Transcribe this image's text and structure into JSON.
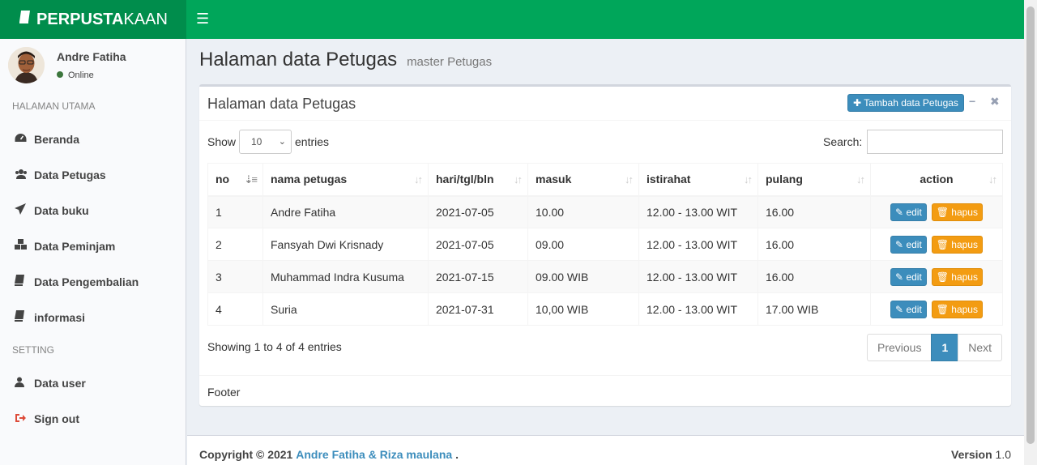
{
  "app": {
    "logo_bold": "PERPUSTA",
    "logo_rest": "KAAN"
  },
  "user": {
    "name": "Andre Fatiha",
    "status": "Online"
  },
  "sidebar": {
    "header_main": "HALAMAN UTAMA",
    "items": [
      {
        "label": "Beranda",
        "icon": "dashboard-icon"
      },
      {
        "label": "Data Petugas",
        "icon": "users-icon"
      },
      {
        "label": "Data buku",
        "icon": "send-icon"
      },
      {
        "label": "Data Peminjam",
        "icon": "cubes-icon"
      },
      {
        "label": "Data Pengembalian",
        "icon": "book-icon"
      },
      {
        "label": "informasi",
        "icon": "book-icon"
      }
    ],
    "header_setting": "SETTING",
    "setting_items": [
      {
        "label": "Data user",
        "icon": "user-icon"
      },
      {
        "label": "Sign out",
        "icon": "sign-out-icon"
      }
    ]
  },
  "page": {
    "title": "Halaman data Petugas",
    "subtitle": "master Petugas"
  },
  "box": {
    "title": "Halaman data Petugas",
    "add_button": "Tambah data Petugas",
    "show_label": "Show",
    "length_value": "10",
    "entries_label": "entries",
    "search_label": "Search:",
    "info": "Showing 1 to 4 of 4 entries",
    "pager": {
      "previous": "Previous",
      "current": "1",
      "next": "Next"
    },
    "footer": "Footer"
  },
  "table": {
    "columns": [
      "no",
      "nama petugas",
      "hari/tgl/bln",
      "masuk",
      "istirahat",
      "pulang",
      "action"
    ],
    "rows": [
      [
        "1",
        "Andre Fatiha",
        "2021-07-05",
        "10.00",
        "12.00 - 13.00 WIT",
        "16.00"
      ],
      [
        "2",
        "Fansyah Dwi Krisnady",
        "2021-07-05",
        "09.00",
        "12.00 - 13.00 WIT",
        "16.00"
      ],
      [
        "3",
        "Muhammad Indra Kusuma",
        "2021-07-15",
        "09.00 WIB",
        "12.00 - 13.00 WIT",
        "16.00"
      ],
      [
        "4",
        "Suria",
        "2021-07-31",
        "10,00 WIB",
        "12.00 - 13.00 WIT",
        "17.00 WIB"
      ]
    ],
    "edit_label": "edit",
    "delete_label": "hapus"
  },
  "footer": {
    "copyright": "Copyright © 2021",
    "authors": "Andre Fatiha & Riza maulana",
    "dot": ".",
    "version_label": "Version",
    "version_value": "1.0"
  },
  "colors": {
    "header": "#00a65a",
    "logo": "#008d4c",
    "primary": "#3c8dbc",
    "warning": "#f39c12"
  }
}
